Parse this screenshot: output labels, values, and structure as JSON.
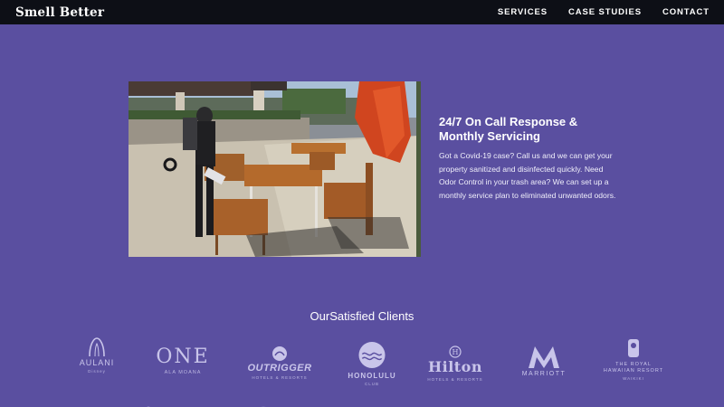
{
  "nav": {
    "brand": "Smell Better",
    "links": [
      "SERVICES",
      "CASE STUDIES",
      "CONTACT"
    ]
  },
  "feature": {
    "title": "24/7 On Call Response & Monthly Servicing",
    "body": "Got a Covid-19 case? Call us and we can get your property sanitized and disinfected quickly. Need Odor Control in your trash area? We can set up a monthly service plan to eliminated unwanted odors."
  },
  "clients": {
    "heading": "OurSatisfied Clients",
    "logos": [
      {
        "name": "AULANI",
        "sub": "Disney",
        "icon": "arch-icon"
      },
      {
        "name": "ONE",
        "sub": "ALA MOANA",
        "icon": ""
      },
      {
        "name": "OUTRIGGER",
        "sub": "HOTELS & RESORTS",
        "icon": "outrigger-icon"
      },
      {
        "name": "HONOLULU",
        "sub": "CLUB",
        "icon": "wave-circle-icon"
      },
      {
        "name": "Hilton",
        "sub": "HOTELS & RESORTS",
        "icon": "hilton-icon"
      },
      {
        "name": "MARRIOTT",
        "sub": "",
        "icon": "m-icon"
      },
      {
        "name": "THE ROYAL HAWAIIAN RESORT",
        "sub": "WAIKIKI",
        "icon": "crest-icon"
      }
    ]
  },
  "colors": {
    "background": "#5a4fa0",
    "nav": "#0d0f16",
    "logo": "#c9c5ea"
  }
}
